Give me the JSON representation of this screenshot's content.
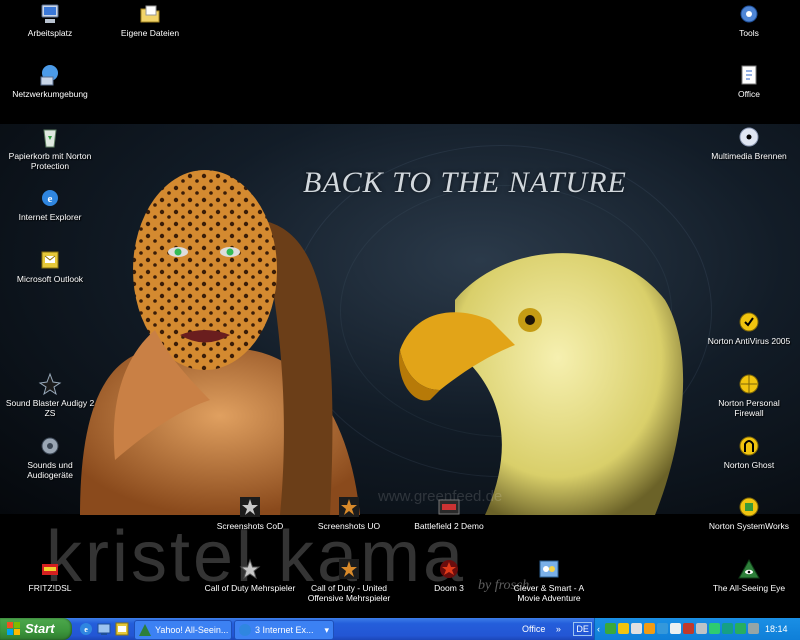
{
  "wallpaper": {
    "title": "BACK TO THE NATURE",
    "site": "www.greenfeed.de",
    "signature": "kristel kama",
    "credit": "by frosch"
  },
  "desktop": {
    "icons": [
      {
        "label": "Arbeitsplatz",
        "icon": "my-computer-icon"
      },
      {
        "label": "Eigene Dateien",
        "icon": "my-documents-icon"
      },
      {
        "label": "Netzwerkumgebung",
        "icon": "network-icon"
      },
      {
        "label": "Papierkorb mit Norton Protection",
        "icon": "recycle-bin-icon"
      },
      {
        "label": "Internet Explorer",
        "icon": "internet-explorer-icon"
      },
      {
        "label": "Microsoft Outlook",
        "icon": "outlook-icon"
      },
      {
        "label": "Sound Blaster Audigy 2 ZS",
        "icon": "sound-blaster-icon"
      },
      {
        "label": "Sounds und Audiogeräte",
        "icon": "speaker-icon"
      },
      {
        "label": "FRITZ!DSL",
        "icon": "fritz-dsl-icon"
      },
      {
        "label": "Screenshots CoD",
        "icon": "star-icon"
      },
      {
        "label": "Screenshots UO",
        "icon": "star-icon"
      },
      {
        "label": "Battlefield 2 Demo",
        "icon": "battlefield-icon"
      },
      {
        "label": "Call of Duty Mehrspieler",
        "icon": "star-icon"
      },
      {
        "label": "Call of Duty - United Offensive Mehrspieler",
        "icon": "star-icon"
      },
      {
        "label": "Doom 3",
        "icon": "doom-icon"
      },
      {
        "label": "Clever & Smart - A Movie Adventure",
        "icon": "game-icon"
      },
      {
        "label": "Tools",
        "icon": "gear-icon"
      },
      {
        "label": "Office",
        "icon": "office-icon"
      },
      {
        "label": "Multimedia Brennen",
        "icon": "cd-icon"
      },
      {
        "label": "Norton AntiVirus 2005",
        "icon": "norton-antivirus-icon"
      },
      {
        "label": "Norton Personal Firewall",
        "icon": "norton-firewall-icon"
      },
      {
        "label": "Norton Ghost",
        "icon": "norton-ghost-icon"
      },
      {
        "label": "Norton SystemWorks",
        "icon": "norton-systemworks-icon"
      },
      {
        "label": "The All-Seeing Eye",
        "icon": "all-seeing-eye-icon"
      }
    ]
  },
  "taskbar": {
    "start_label": "Start",
    "windows": [
      {
        "label": "Yahoo! All-Seein...",
        "icon": "yahoo-icon"
      },
      {
        "label": "3 Internet Ex...",
        "icon": "internet-explorer-icon"
      }
    ],
    "toolbar_label": "Office",
    "toolbar_chevron": "»",
    "language": "DE",
    "clock": "18:14"
  },
  "colors": {
    "taskbar": "#245edb",
    "start_button": "#3c963c",
    "tray": "#0f7fd8"
  }
}
